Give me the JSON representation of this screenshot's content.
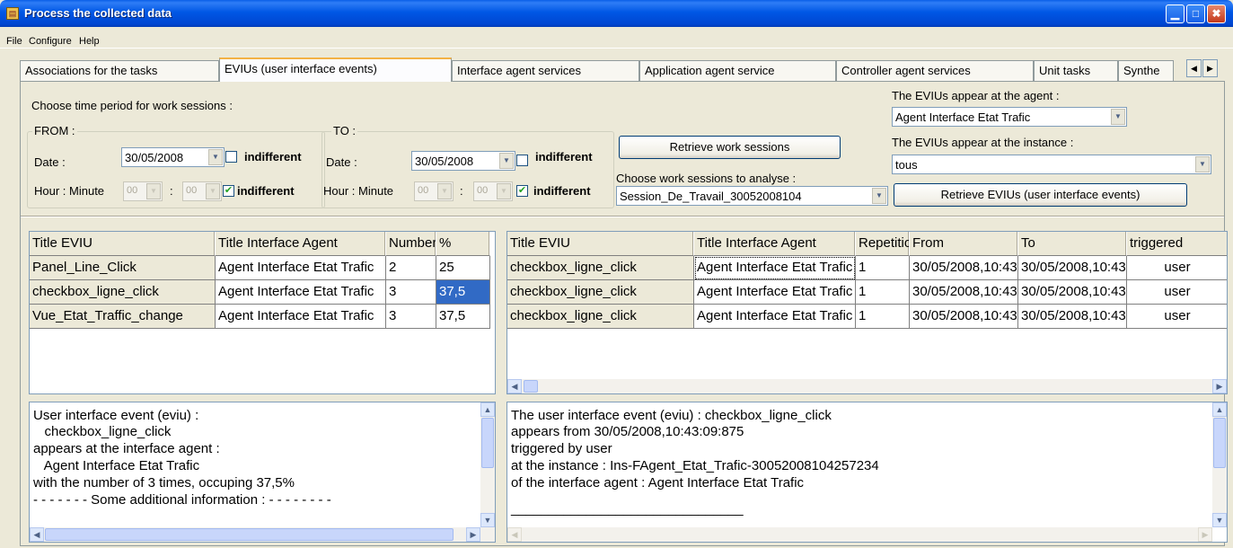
{
  "window": {
    "title": "Process the collected data",
    "icon_glyph": "▤",
    "minimize_glyph": "▁",
    "maximize_glyph": "□",
    "close_glyph": "✖"
  },
  "menu": [
    "File",
    "Configure",
    "Help"
  ],
  "tabs": [
    "Associations for the tasks",
    "EVIUs (user interface events)",
    "Interface agent services",
    "Application agent service",
    "Controller agent services",
    "Unit tasks",
    "Synthe"
  ],
  "active_tab": 1,
  "tab_scroll": {
    "left": "◀",
    "right": "▶"
  },
  "controls": {
    "choose_period_label": "Choose time period for work sessions :",
    "from_label": "FROM :",
    "to_label": "TO :",
    "date_label": "Date :",
    "hour_label": "Hour : Minute",
    "from_date": "30/05/2008",
    "to_date": "30/05/2008",
    "indifferent_label": "indifferent",
    "hour_value": "00",
    "minute_value": "00",
    "hour_separator": ":",
    "retrieve_sessions_button": "Retrieve work sessions",
    "choose_sessions_label": "Choose work sessions to analyse :",
    "session_value": "Session_De_Travail_30052008104",
    "agent_label": "The EVIUs appear at the agent :",
    "agent_value": "Agent Interface Etat Trafic",
    "instance_label": "The EVIUs appear at the instance :",
    "instance_value": "tous",
    "retrieve_evius_button": "Retrieve EVIUs (user interface events)",
    "checkmark": "✔",
    "arrow": "▼"
  },
  "left_table": {
    "headers": [
      "Title EVIU",
      "Title Interface Agent",
      "Number",
      "%"
    ],
    "rows": [
      [
        "Panel_Line_Click",
        "Agent Interface Etat Trafic",
        "2",
        "25"
      ],
      [
        "checkbox_ligne_click",
        "Agent Interface Etat Trafic",
        "3",
        "37,5"
      ],
      [
        "Vue_Etat_Traffic_change",
        "Agent Interface Etat Trafic",
        "3",
        "37,5"
      ]
    ]
  },
  "right_table": {
    "headers": [
      "Title EVIU",
      "Title Interface Agent",
      "Repetition",
      "From",
      "To",
      "triggered"
    ],
    "rows": [
      [
        "checkbox_ligne_click",
        "Agent Interface Etat Trafic",
        "1",
        "30/05/2008,10:43",
        "30/05/2008,10:43",
        "user"
      ],
      [
        "checkbox_ligne_click",
        "Agent Interface Etat Trafic",
        "1",
        "30/05/2008,10:43",
        "30/05/2008,10:43",
        "user"
      ],
      [
        "checkbox_ligne_click",
        "Agent Interface Etat Trafic",
        "1",
        "30/05/2008,10:43",
        "30/05/2008,10:43",
        "user"
      ]
    ]
  },
  "left_text": [
    "User interface event (eviu) :",
    "   checkbox_ligne_click",
    "appears at the interface agent :",
    "   Agent Interface Etat Trafic",
    "with the number of 3 times, occuping 37,5%",
    "- - - - - - - Some additional information : - - - - - - - -"
  ],
  "right_text": [
    "The user interface event (eviu) : checkbox_ligne_click",
    "appears from 30/05/2008,10:43:09:875",
    "triggered by user",
    "at the instance : Ins-FAgent_Etat_Trafic-30052008104257234",
    "of the interface agent : Agent Interface Etat Trafic",
    "_______________________________"
  ],
  "scroll_glyphs": {
    "up": "▲",
    "down": "▼",
    "left": "◀",
    "right": "▶"
  }
}
